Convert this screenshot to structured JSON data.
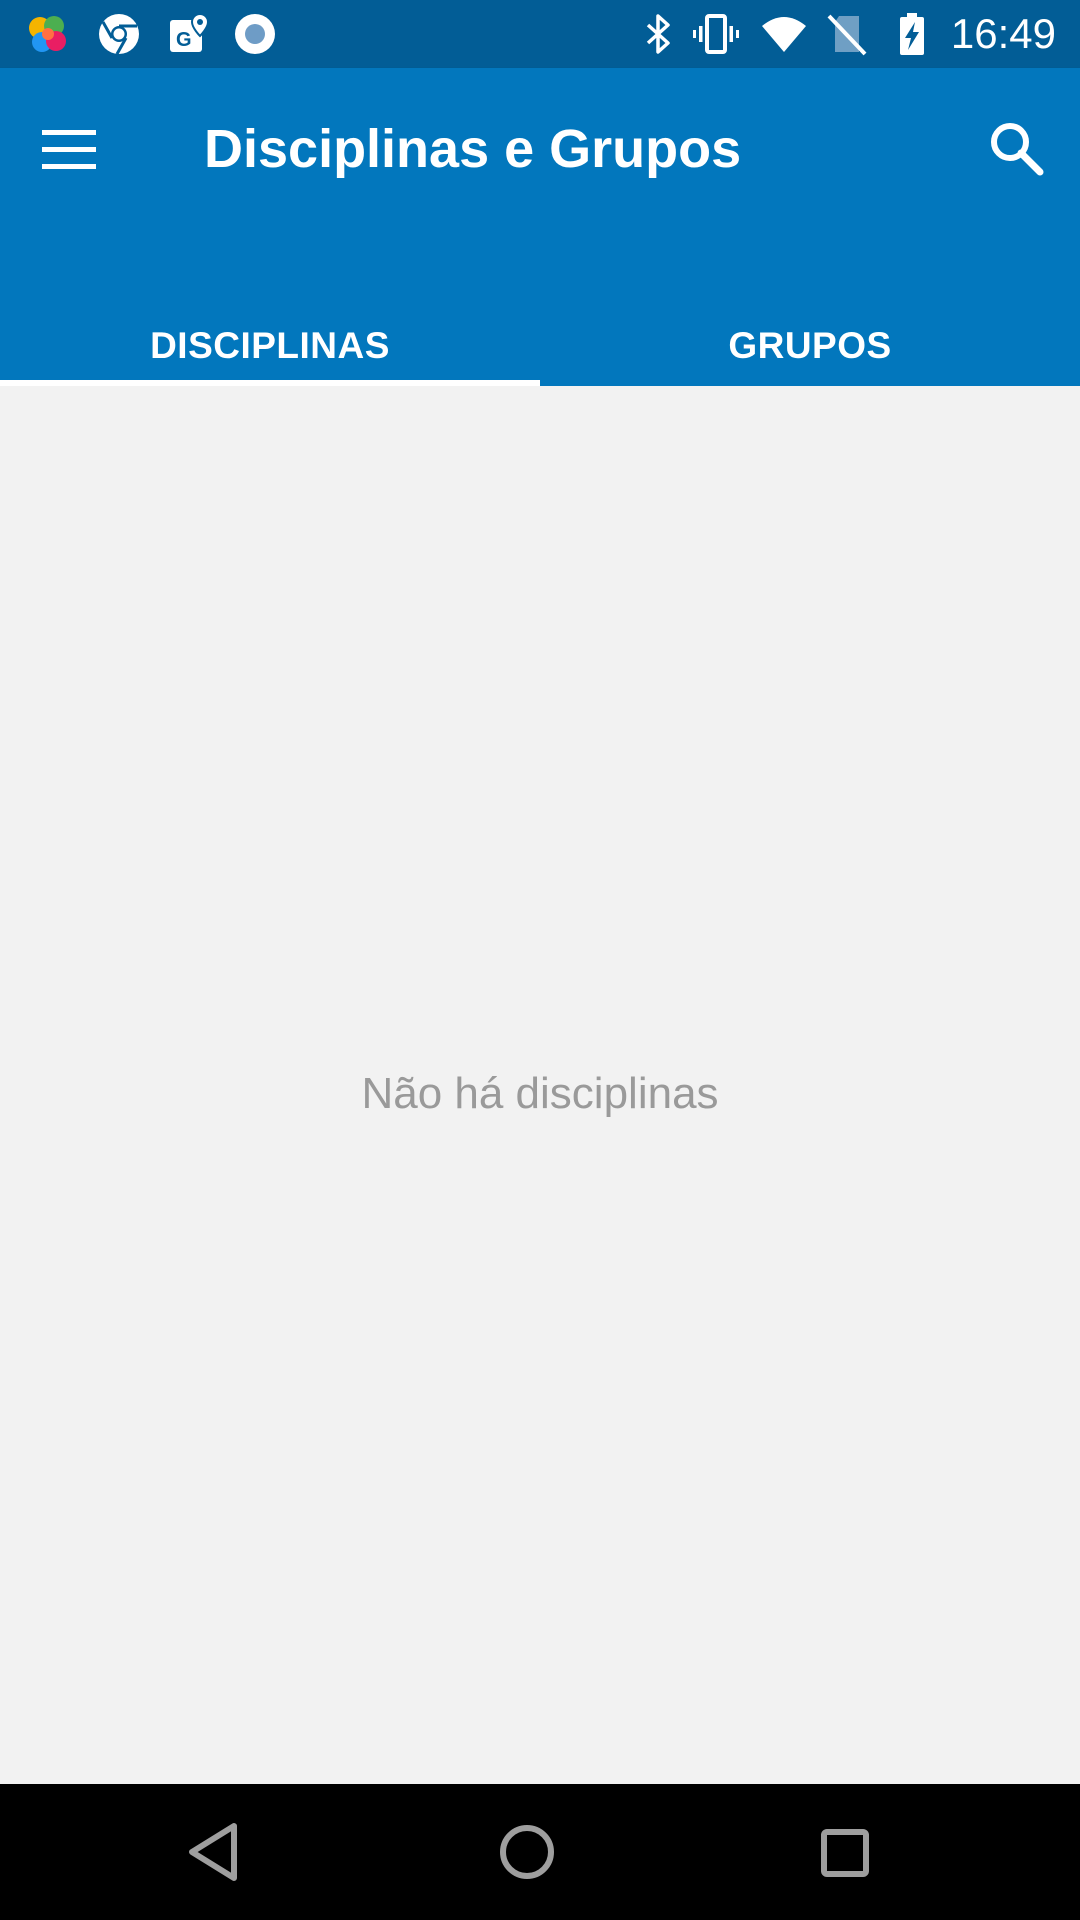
{
  "status_bar": {
    "time": "16:49",
    "left_icons": [
      "puzzle-app-icon",
      "chrome-icon",
      "maps-icon",
      "circle-app-icon"
    ],
    "right_icons": [
      "bluetooth-icon",
      "vibrate-icon",
      "wifi-icon",
      "no-sim-icon",
      "battery-charging-icon"
    ]
  },
  "app_bar": {
    "title": "Disciplinas e Grupos",
    "menu_icon": "hamburger-menu-icon",
    "search_icon": "search-icon"
  },
  "tabs": [
    {
      "label": "DISCIPLINAS",
      "selected": true
    },
    {
      "label": "GRUPOS",
      "selected": false
    }
  ],
  "content": {
    "empty_message": "Não há disciplinas"
  },
  "nav_bar": {
    "icons": [
      "back-icon",
      "home-icon",
      "recents-icon"
    ]
  },
  "colors": {
    "status_bar": "#025d96",
    "app_bar": "#0277bd",
    "background": "#f2f2f2",
    "empty_text": "#9a9a9a",
    "nav_bar": "#000000"
  }
}
